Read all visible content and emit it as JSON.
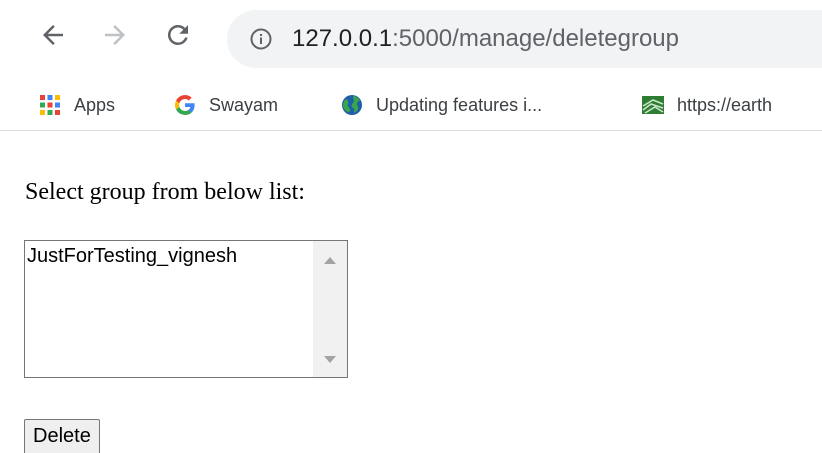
{
  "browser": {
    "url_host": "127.0.0.1",
    "url_path": ":5000/manage/deletegroup",
    "icons": {
      "back": "arrow-left-icon",
      "forward": "arrow-right-icon",
      "reload": "reload-icon",
      "info": "info-icon"
    }
  },
  "bookmarks": [
    {
      "label": "Apps",
      "icon": "apps-grid-icon"
    },
    {
      "label": "Swayam",
      "icon": "google-g-icon"
    },
    {
      "label": "Updating features i...",
      "icon": "globe-icon"
    },
    {
      "label": "https://earth",
      "icon": "earth-engine-icon"
    }
  ],
  "page": {
    "prompt": "Select group from below list:",
    "list_options": [
      "JustForTesting_vignesh"
    ],
    "delete_label": "Delete"
  },
  "colors": {
    "omnibox_bg": "#f1f3f4",
    "nav_active": "#5f6368",
    "nav_disabled": "#bdc1c6"
  }
}
